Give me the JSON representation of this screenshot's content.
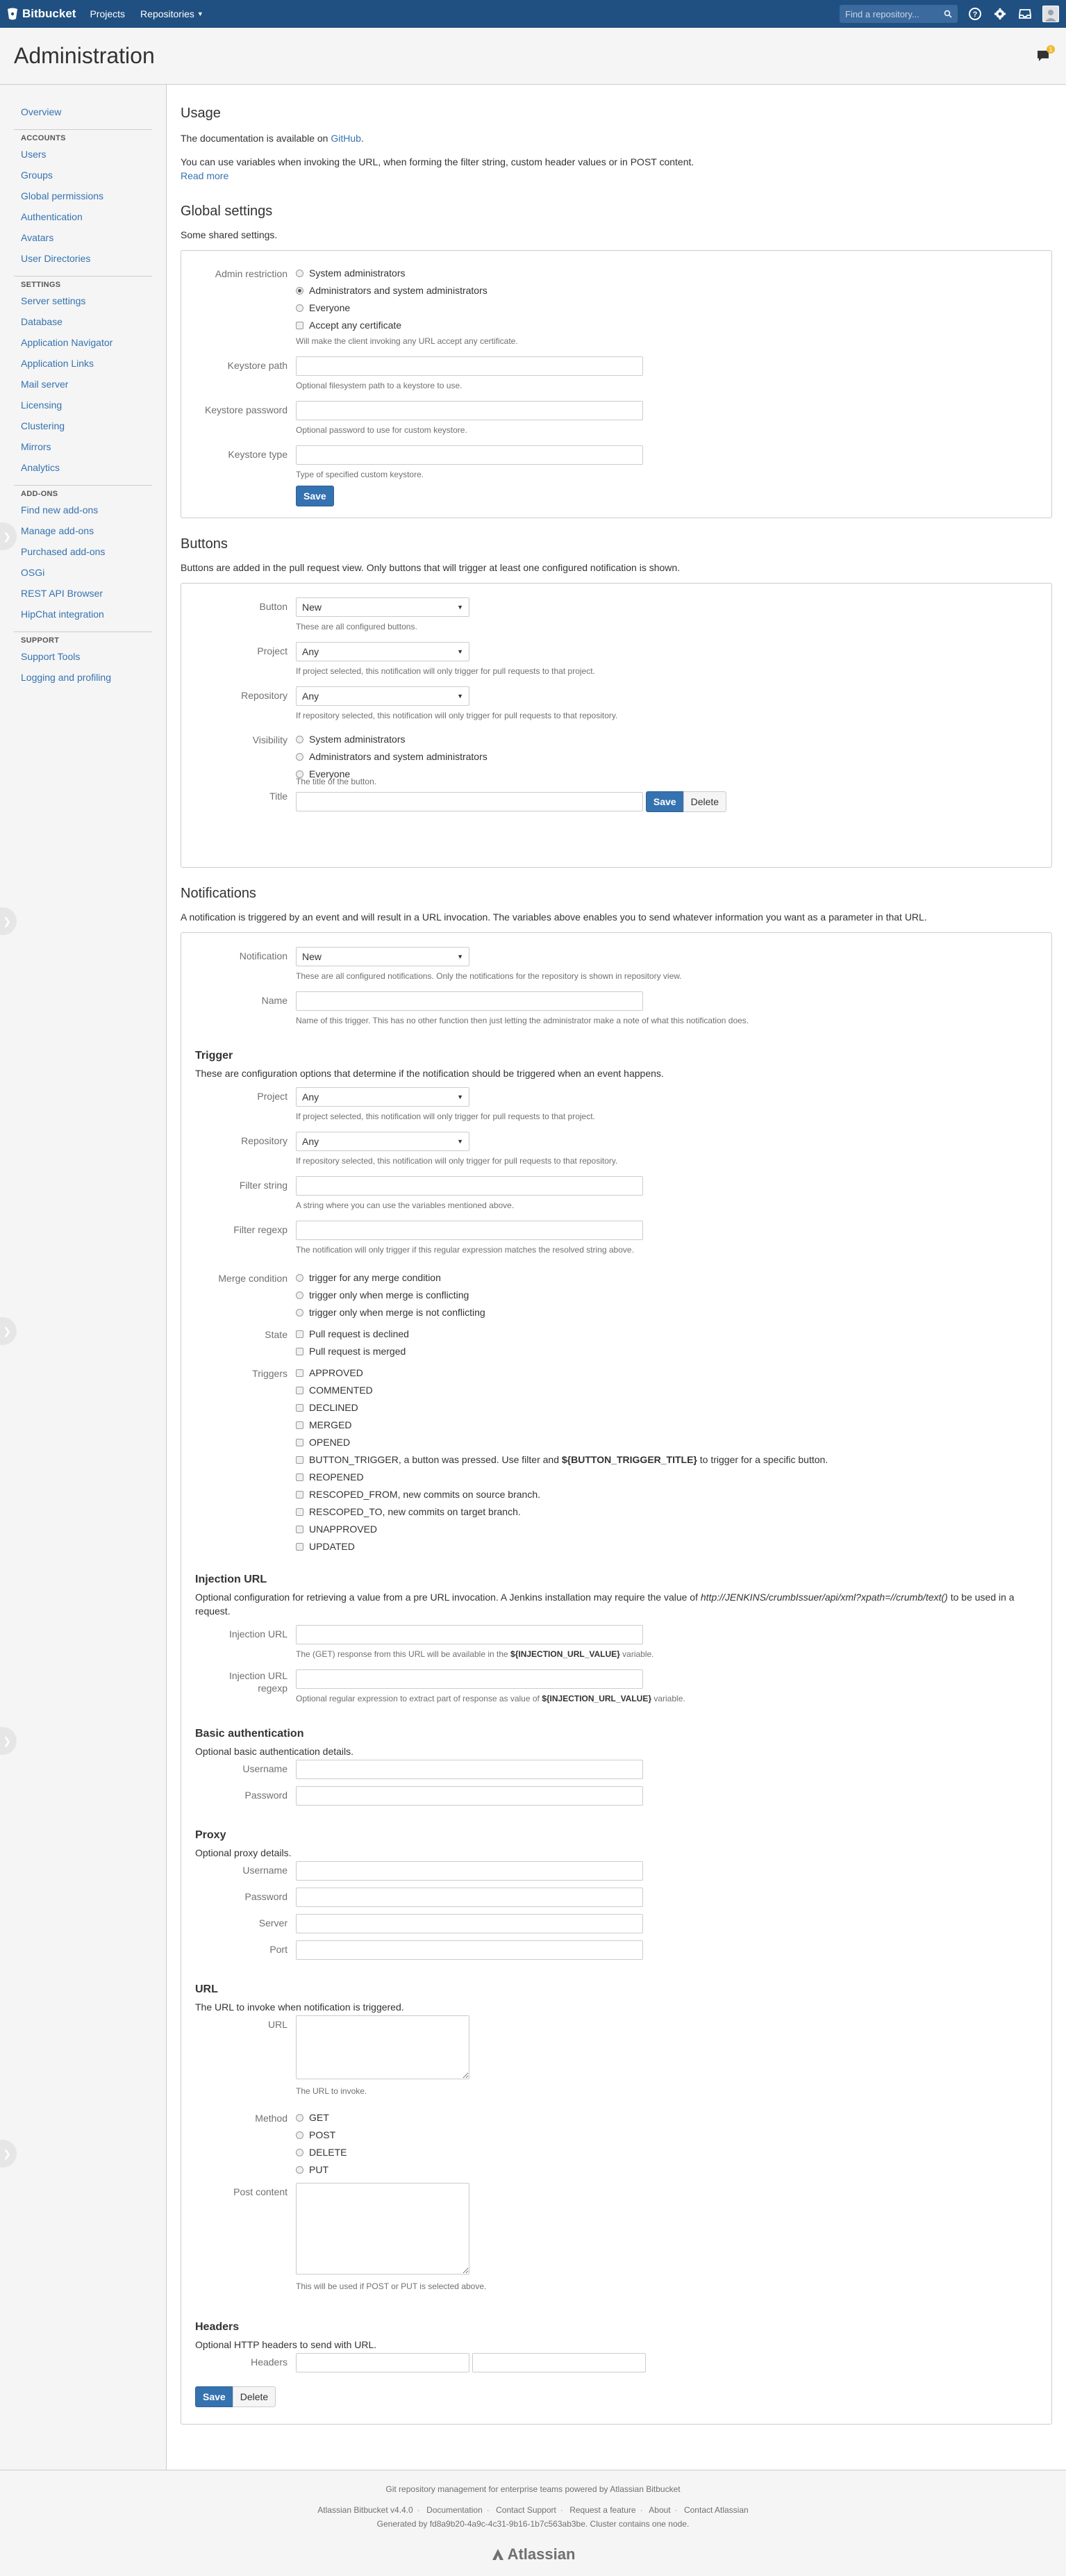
{
  "nav": {
    "brand": "Bitbucket",
    "projects": "Projects",
    "repositories": "Repositories",
    "search_placeholder": "Find a repository..."
  },
  "header": {
    "title": "Administration",
    "notif_count": "1"
  },
  "sidebar": {
    "overview": "Overview",
    "sections": [
      {
        "title": "ACCOUNTS",
        "items": [
          "Users",
          "Groups",
          "Global permissions",
          "Authentication",
          "Avatars",
          "User Directories"
        ]
      },
      {
        "title": "SETTINGS",
        "items": [
          "Server settings",
          "Database",
          "Application Navigator",
          "Application Links",
          "Mail server",
          "Licensing",
          "Clustering",
          "Mirrors",
          "Analytics"
        ]
      },
      {
        "title": "ADD-ONS",
        "items": [
          "Find new add-ons",
          "Manage add-ons",
          "Purchased add-ons",
          "OSGi",
          "REST API Browser",
          "HipChat integration"
        ]
      },
      {
        "title": "SUPPORT",
        "items": [
          "Support Tools",
          "Logging and profiling"
        ]
      }
    ]
  },
  "usage": {
    "title": "Usage",
    "doc_prefix": "The documentation is available on ",
    "doc_link": "GitHub",
    "doc_suffix": ".",
    "variables_text": "You can use variables when invoking the URL, when forming the filter string, custom header values or in POST content.",
    "read_more": "Read more"
  },
  "global": {
    "title": "Global settings",
    "desc": "Some shared settings.",
    "admin_label": "Admin restriction",
    "admin_options": [
      "System administrators",
      "Administrators and system administrators",
      "Everyone"
    ],
    "accept_cert": "Accept any certificate",
    "accept_help": "Will make the client invoking any URL accept any certificate.",
    "keystore_path_label": "Keystore path",
    "keystore_path_help": "Optional filesystem path to a keystore to use.",
    "keystore_password_label": "Keystore password",
    "keystore_password_help": "Optional password to use for custom keystore.",
    "keystore_type_label": "Keystore type",
    "keystore_type_help": "Type of specified custom keystore.",
    "save": "Save"
  },
  "buttons": {
    "title": "Buttons",
    "desc": "Buttons are added in the pull request view. Only buttons that will trigger at least one configured notification is shown.",
    "button_label": "Button",
    "button_value": "New",
    "button_help": "These are all configured buttons.",
    "project_label": "Project",
    "project_value": "Any",
    "project_help": "If project selected, this notification will only trigger for pull requests to that project.",
    "repository_label": "Repository",
    "repository_value": "Any",
    "repository_help": "If repository selected, this notification will only trigger for pull requests to that repository.",
    "visibility_label": "Visibility",
    "visibility_options": [
      "System administrators",
      "Administrators and system administrators",
      "Everyone"
    ],
    "title_label": "Title",
    "title_help": "The title of the button.",
    "save": "Save",
    "delete": "Delete"
  },
  "notifications": {
    "title": "Notifications",
    "desc": "A notification is triggered by an event and will result in a URL invocation. The variables above enables you to send whatever information you want as a parameter in that URL.",
    "notification_label": "Notification",
    "notification_value": "New",
    "notification_help": "These are all configured notifications. Only the notifications for the repository is shown in repository view.",
    "name_label": "Name",
    "name_help": "Name of this trigger. This has no other function then just letting the administrator make a note of what this notification does.",
    "trigger_title": "Trigger",
    "trigger_desc": "These are configuration options that determine if the notification should be triggered when an event happens.",
    "project_label": "Project",
    "project_value": "Any",
    "project_help": "If project selected, this notification will only trigger for pull requests to that project.",
    "repository_label": "Repository",
    "repository_value": "Any",
    "repository_help": "If repository selected, this notification will only trigger for pull requests to that repository.",
    "filter_string_label": "Filter string",
    "filter_string_help": "A string where you can use the variables mentioned above.",
    "filter_regexp_label": "Filter regexp",
    "filter_regexp_help": "The notification will only trigger if this regular expression matches the resolved string above.",
    "merge_label": "Merge condition",
    "merge_options": [
      "trigger for any merge condition",
      "trigger only when merge is conflicting",
      "trigger only when merge is not conflicting"
    ],
    "state_label": "State",
    "state_options": [
      "Pull request is declined",
      "Pull request is merged"
    ],
    "triggers_label": "Triggers",
    "triggers": [
      "APPROVED",
      "COMMENTED",
      "DECLINED",
      "MERGED",
      "OPENED"
    ],
    "button_trigger_prefix": "BUTTON_TRIGGER, a button was pressed. Use filter and ",
    "button_trigger_var": "${BUTTON_TRIGGER_TITLE}",
    "button_trigger_suffix": " to trigger for a specific button.",
    "triggers_after": [
      "REOPENED",
      "RESCOPED_FROM, new commits on source branch.",
      "RESCOPED_TO, new commits on target branch.",
      "UNAPPROVED",
      "UPDATED"
    ],
    "injection_title": "Injection URL",
    "injection_desc_prefix": "Optional configuration for retrieving a value from a pre URL invocation. A Jenkins installation may require the value of ",
    "injection_desc_url": "http://JENKINS/crumbIssuer/api/xml?xpath=//crumb/text()",
    "injection_desc_suffix": " to be used in a request.",
    "injection_url_label": "Injection URL",
    "injection_url_help_prefix": "The (GET) response from this URL will be available in the ",
    "injection_url_help_var": "${INJECTION_URL_VALUE}",
    "injection_url_help_suffix": " variable.",
    "injection_regexp_label_1": "Injection URL",
    "injection_regexp_label_2": "regexp",
    "injection_regexp_help_prefix": "Optional regular expression to extract part of response as value of ",
    "injection_regexp_help_var": "${INJECTION_URL_VALUE}",
    "injection_regexp_help_suffix": " variable.",
    "basic_title": "Basic authentication",
    "basic_desc": "Optional basic authentication details.",
    "username_label": "Username",
    "password_label": "Password",
    "proxy_title": "Proxy",
    "proxy_desc": "Optional proxy details.",
    "proxy_username_label": "Username",
    "proxy_password_label": "Password",
    "proxy_server_label": "Server",
    "proxy_port_label": "Port",
    "url_title": "URL",
    "url_desc": "The URL to invoke when notification is triggered.",
    "url_label": "URL",
    "url_help": "The URL to invoke.",
    "method_label": "Method",
    "methods": [
      "GET",
      "POST",
      "DELETE",
      "PUT"
    ],
    "post_label": "Post content",
    "post_help": "This will be used if POST or PUT is selected above.",
    "headers_title": "Headers",
    "headers_desc": "Optional HTTP headers to send with URL.",
    "headers_label": "Headers",
    "save": "Save",
    "delete": "Delete"
  },
  "footer": {
    "tagline": "Git repository management for enterprise teams powered by Atlassian Bitbucket",
    "links": [
      "Atlassian Bitbucket v4.4.0",
      "Documentation",
      "Contact Support",
      "Request a feature",
      "About",
      "Contact Atlassian"
    ],
    "generated": "Generated by fd8a9b20-4a9c-4c31-9b16-1b7c563ab3be. Cluster contains one node.",
    "atlassian": "Atlassian"
  }
}
